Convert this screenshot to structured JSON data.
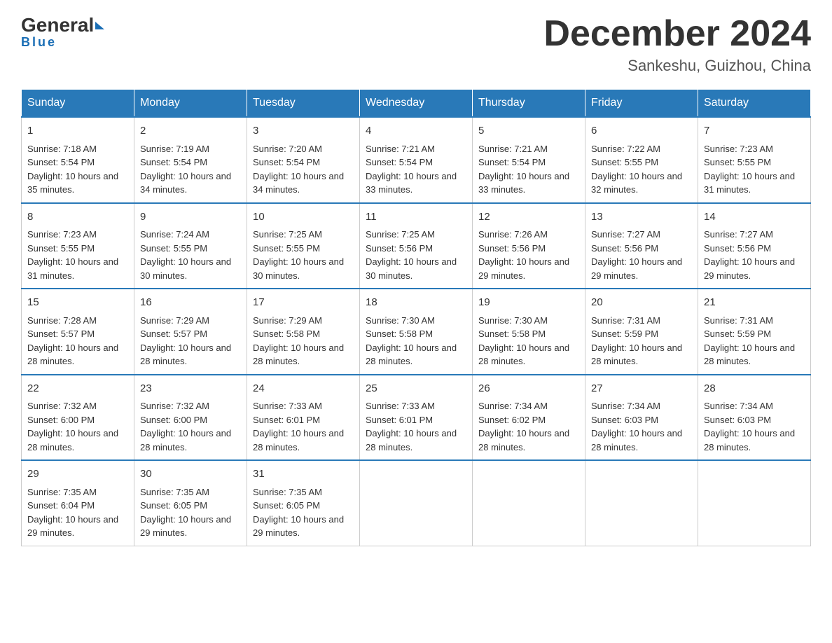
{
  "logo": {
    "general": "General",
    "blue": "Blue",
    "underline": "Blue"
  },
  "title": {
    "month": "December 2024",
    "location": "Sankeshu, Guizhou, China"
  },
  "days": [
    "Sunday",
    "Monday",
    "Tuesday",
    "Wednesday",
    "Thursday",
    "Friday",
    "Saturday"
  ],
  "weeks": [
    [
      {
        "num": "1",
        "sunrise": "7:18 AM",
        "sunset": "5:54 PM",
        "daylight": "10 hours and 35 minutes."
      },
      {
        "num": "2",
        "sunrise": "7:19 AM",
        "sunset": "5:54 PM",
        "daylight": "10 hours and 34 minutes."
      },
      {
        "num": "3",
        "sunrise": "7:20 AM",
        "sunset": "5:54 PM",
        "daylight": "10 hours and 34 minutes."
      },
      {
        "num": "4",
        "sunrise": "7:21 AM",
        "sunset": "5:54 PM",
        "daylight": "10 hours and 33 minutes."
      },
      {
        "num": "5",
        "sunrise": "7:21 AM",
        "sunset": "5:54 PM",
        "daylight": "10 hours and 33 minutes."
      },
      {
        "num": "6",
        "sunrise": "7:22 AM",
        "sunset": "5:55 PM",
        "daylight": "10 hours and 32 minutes."
      },
      {
        "num": "7",
        "sunrise": "7:23 AM",
        "sunset": "5:55 PM",
        "daylight": "10 hours and 31 minutes."
      }
    ],
    [
      {
        "num": "8",
        "sunrise": "7:23 AM",
        "sunset": "5:55 PM",
        "daylight": "10 hours and 31 minutes."
      },
      {
        "num": "9",
        "sunrise": "7:24 AM",
        "sunset": "5:55 PM",
        "daylight": "10 hours and 30 minutes."
      },
      {
        "num": "10",
        "sunrise": "7:25 AM",
        "sunset": "5:55 PM",
        "daylight": "10 hours and 30 minutes."
      },
      {
        "num": "11",
        "sunrise": "7:25 AM",
        "sunset": "5:56 PM",
        "daylight": "10 hours and 30 minutes."
      },
      {
        "num": "12",
        "sunrise": "7:26 AM",
        "sunset": "5:56 PM",
        "daylight": "10 hours and 29 minutes."
      },
      {
        "num": "13",
        "sunrise": "7:27 AM",
        "sunset": "5:56 PM",
        "daylight": "10 hours and 29 minutes."
      },
      {
        "num": "14",
        "sunrise": "7:27 AM",
        "sunset": "5:56 PM",
        "daylight": "10 hours and 29 minutes."
      }
    ],
    [
      {
        "num": "15",
        "sunrise": "7:28 AM",
        "sunset": "5:57 PM",
        "daylight": "10 hours and 28 minutes."
      },
      {
        "num": "16",
        "sunrise": "7:29 AM",
        "sunset": "5:57 PM",
        "daylight": "10 hours and 28 minutes."
      },
      {
        "num": "17",
        "sunrise": "7:29 AM",
        "sunset": "5:58 PM",
        "daylight": "10 hours and 28 minutes."
      },
      {
        "num": "18",
        "sunrise": "7:30 AM",
        "sunset": "5:58 PM",
        "daylight": "10 hours and 28 minutes."
      },
      {
        "num": "19",
        "sunrise": "7:30 AM",
        "sunset": "5:58 PM",
        "daylight": "10 hours and 28 minutes."
      },
      {
        "num": "20",
        "sunrise": "7:31 AM",
        "sunset": "5:59 PM",
        "daylight": "10 hours and 28 minutes."
      },
      {
        "num": "21",
        "sunrise": "7:31 AM",
        "sunset": "5:59 PM",
        "daylight": "10 hours and 28 minutes."
      }
    ],
    [
      {
        "num": "22",
        "sunrise": "7:32 AM",
        "sunset": "6:00 PM",
        "daylight": "10 hours and 28 minutes."
      },
      {
        "num": "23",
        "sunrise": "7:32 AM",
        "sunset": "6:00 PM",
        "daylight": "10 hours and 28 minutes."
      },
      {
        "num": "24",
        "sunrise": "7:33 AM",
        "sunset": "6:01 PM",
        "daylight": "10 hours and 28 minutes."
      },
      {
        "num": "25",
        "sunrise": "7:33 AM",
        "sunset": "6:01 PM",
        "daylight": "10 hours and 28 minutes."
      },
      {
        "num": "26",
        "sunrise": "7:34 AM",
        "sunset": "6:02 PM",
        "daylight": "10 hours and 28 minutes."
      },
      {
        "num": "27",
        "sunrise": "7:34 AM",
        "sunset": "6:03 PM",
        "daylight": "10 hours and 28 minutes."
      },
      {
        "num": "28",
        "sunrise": "7:34 AM",
        "sunset": "6:03 PM",
        "daylight": "10 hours and 28 minutes."
      }
    ],
    [
      {
        "num": "29",
        "sunrise": "7:35 AM",
        "sunset": "6:04 PM",
        "daylight": "10 hours and 29 minutes."
      },
      {
        "num": "30",
        "sunrise": "7:35 AM",
        "sunset": "6:05 PM",
        "daylight": "10 hours and 29 minutes."
      },
      {
        "num": "31",
        "sunrise": "7:35 AM",
        "sunset": "6:05 PM",
        "daylight": "10 hours and 29 minutes."
      },
      null,
      null,
      null,
      null
    ]
  ]
}
